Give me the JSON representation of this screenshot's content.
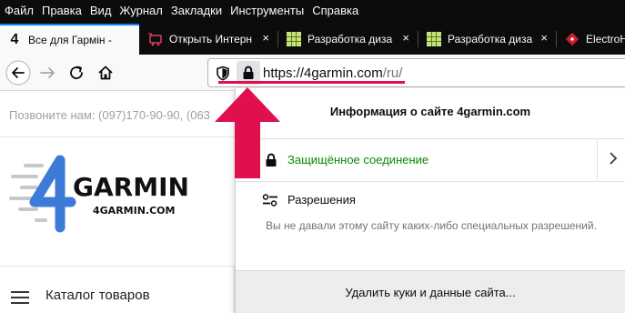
{
  "menubar": {
    "items": [
      "Файл",
      "Правка",
      "Вид",
      "Журнал",
      "Закладки",
      "Инструменты",
      "Справка"
    ]
  },
  "tabs": [
    {
      "title": "Все для Гармін -",
      "icon": "4garmin-favicon",
      "active": true
    },
    {
      "title": "Открыть Интерн",
      "icon": "cart-favicon",
      "active": false
    },
    {
      "title": "Разработка диза",
      "icon": "grid-favicon",
      "active": false
    },
    {
      "title": "Разработка диза",
      "icon": "grid-favicon",
      "active": false
    },
    {
      "title": "ElectroH",
      "icon": "red-diamond-favicon",
      "active": false
    }
  ],
  "tab_close_glyph": "×",
  "navbar": {
    "url_host": "https://4garmin.com",
    "url_path": "/ru/"
  },
  "page": {
    "phone_text": "Позвоните нам: (097)170-90-90, (063",
    "logo_main": "GARMIN",
    "logo_sub": "4GARMIN.COM",
    "catalog_label": "Каталог товаров"
  },
  "popup": {
    "title": "Информация о сайте 4garmin.com",
    "secure_label": "Защищённое соединение",
    "permissions_title": "Разрешения",
    "permissions_desc": "Вы не давали этому сайту каких-либо специальных разрешений.",
    "clear_button": "Удалить куки и данные сайта..."
  },
  "colors": {
    "accent_arrow": "#e0104f",
    "secure_green": "#058b00",
    "logo_blue": "#3d7bd9"
  }
}
